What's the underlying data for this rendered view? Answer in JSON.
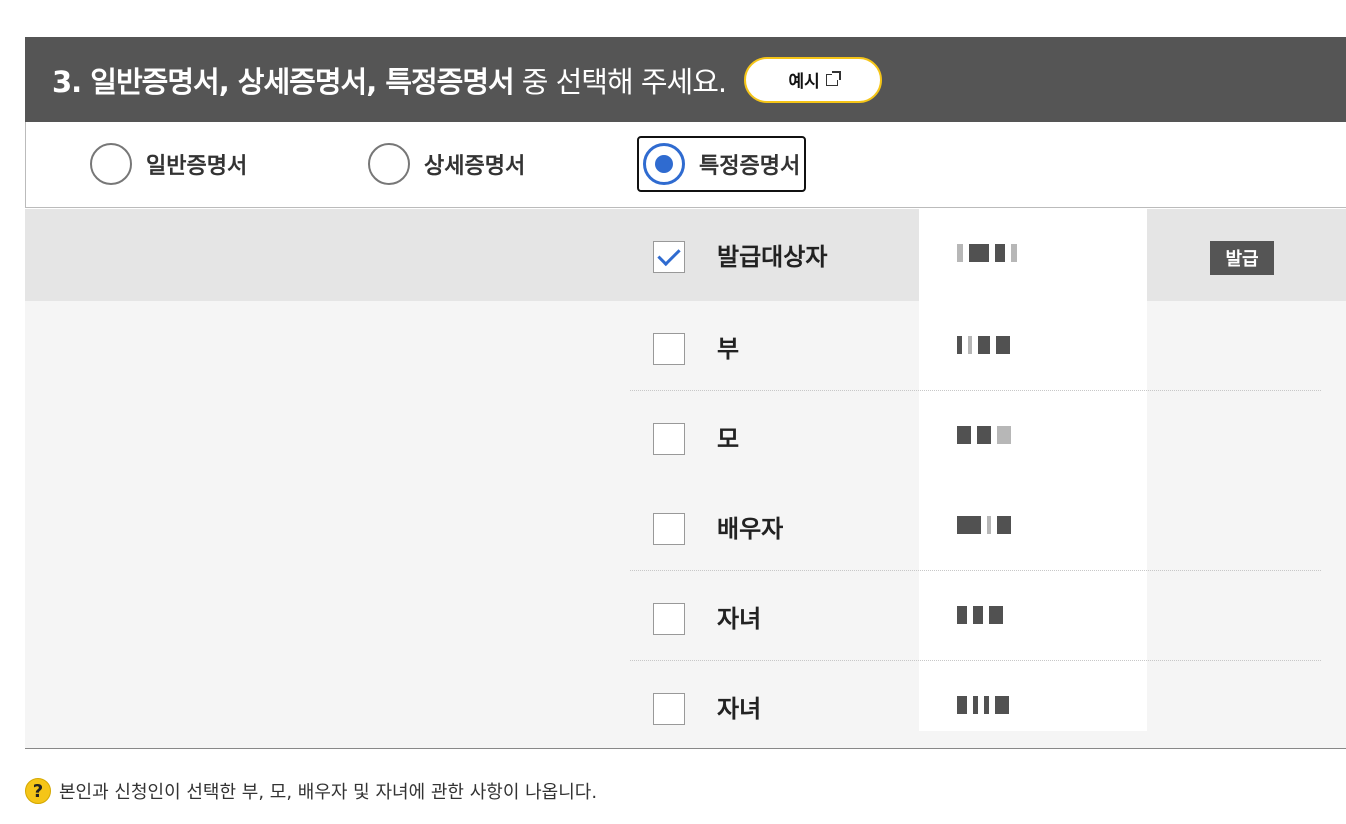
{
  "header": {
    "title_strong": "3. 일반증명서, 상세증명서, 특정증명서",
    "title_rest": "중 선택해 주세요.",
    "example_button": "예시"
  },
  "certificate_types": [
    {
      "label": "일반증명서",
      "selected": false
    },
    {
      "label": "상세증명서",
      "selected": false
    },
    {
      "label": "특정증명서",
      "selected": true
    }
  ],
  "persons": [
    {
      "relation": "발급대상자",
      "checked": true,
      "issue_badge": "발급"
    },
    {
      "relation": "부",
      "checked": false
    },
    {
      "relation": "모",
      "checked": false
    },
    {
      "relation": "배우자",
      "checked": false
    },
    {
      "relation": "자녀",
      "checked": false
    },
    {
      "relation": "자녀",
      "checked": false
    }
  ],
  "note": {
    "icon": "question-icon",
    "text": "본인과 신청인이 선택한 부, 모, 배우자 및 자녀에 관한 사항이 나옵니다."
  },
  "colors": {
    "header_bg": "#555555",
    "accent_yellow": "#f5c518",
    "radio_blue": "#2f6bd0"
  }
}
